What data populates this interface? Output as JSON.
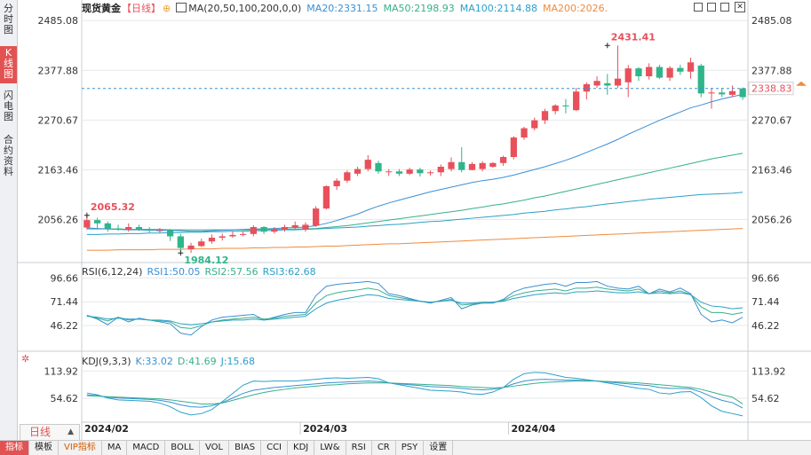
{
  "side_tabs": [
    {
      "label": "分时图",
      "active": false
    },
    {
      "label": "K线图",
      "active": true
    },
    {
      "label": "闪电图",
      "active": false
    },
    {
      "label": "合约资料",
      "active": false
    }
  ],
  "header": {
    "name": "现货黄金",
    "period": "【日线】",
    "ma_label": "MA(20,50,100,200,0,0)",
    "ma20": "MA20:2331.15",
    "ma50": "MA50:2198.93",
    "ma100": "MA100:2114.88",
    "ma200": "MA200:2026."
  },
  "rsi_header": {
    "name": "RSI(6,12,24)",
    "rsi1": "RSI1:50.05",
    "rsi2": "RSI2:57.56",
    "rsi3": "RSI3:62.68"
  },
  "kdj_header": {
    "name": "KDJ(9,3,3)",
    "k": "K:33.02",
    "d": "D:41.69",
    "j": "J:15.68"
  },
  "period_button": {
    "label": "日线",
    "arrow": "▲"
  },
  "bottom_tabs": [
    {
      "label": "指标",
      "active": true,
      "vip": false
    },
    {
      "label": "模板",
      "active": false,
      "vip": false
    },
    {
      "label": "VIP指标",
      "active": false,
      "vip": true
    },
    {
      "label": "MA",
      "active": false,
      "vip": false
    },
    {
      "label": "MACD",
      "active": false,
      "vip": false
    },
    {
      "label": "BOLL",
      "active": false,
      "vip": false
    },
    {
      "label": "VOL",
      "active": false,
      "vip": false
    },
    {
      "label": "BIAS",
      "active": false,
      "vip": false
    },
    {
      "label": "CCI",
      "active": false,
      "vip": false
    },
    {
      "label": "KDJ",
      "active": false,
      "vip": false
    },
    {
      "label": "LW&",
      "active": false,
      "vip": false
    },
    {
      "label": "RSI",
      "active": false,
      "vip": false
    },
    {
      "label": "CR",
      "active": false,
      "vip": false
    },
    {
      "label": "PSY",
      "active": false,
      "vip": false
    },
    {
      "label": "设置",
      "active": false,
      "vip": false
    }
  ],
  "colors": {
    "up": "#e8505b",
    "down": "#2fb58a",
    "ma20": "#3a8fd4",
    "ma50": "#37b08a",
    "ma100": "#2aa0c8",
    "ma200": "#f08a3c",
    "grid": "#e6e8eb",
    "dashed": "#3a8fd4"
  },
  "chart_data": [
    {
      "type": "candlestick",
      "title": "现货黄金",
      "yticks": [
        "2485.08",
        "2377.88",
        "2270.67",
        "2163.46",
        "2056.26"
      ],
      "ylim": [
        1975,
        2495
      ],
      "xticks": [
        "2024/02",
        "2024/03",
        "2024/04"
      ],
      "xtick_index": [
        0,
        21,
        41
      ],
      "current_price": 2338.83,
      "annotations": [
        {
          "text": "2065.32",
          "index": 0,
          "value": 2065.32,
          "kind": "high"
        },
        {
          "text": "1984.12",
          "index": 9,
          "value": 1984.12,
          "kind": "low"
        },
        {
          "text": "2431.41",
          "index": 50,
          "value": 2431.41,
          "kind": "high"
        }
      ],
      "candles": [
        [
          2039,
          2055,
          2065.32,
          2035
        ],
        [
          2055,
          2048,
          2060,
          2035
        ],
        [
          2048,
          2037,
          2052,
          2030
        ],
        [
          2037,
          2035,
          2045,
          2032
        ],
        [
          2035,
          2040,
          2048,
          2030
        ],
        [
          2040,
          2035,
          2045,
          2032
        ],
        [
          2035,
          2033,
          2040,
          2028
        ],
        [
          2033,
          2033,
          2038,
          2028
        ],
        [
          2033,
          2020,
          2036,
          2010
        ],
        [
          2020,
          1995,
          2025,
          1987
        ],
        [
          1992,
          2000,
          2006,
          1984.12
        ],
        [
          1999,
          2009,
          2015,
          1997
        ],
        [
          2009,
          2017,
          2024,
          2004
        ],
        [
          2017,
          2020,
          2026,
          2011
        ],
        [
          2020,
          2023,
          2030,
          2017
        ],
        [
          2023,
          2025,
          2031,
          2020
        ],
        [
          2025,
          2040,
          2044,
          2020
        ],
        [
          2040,
          2030,
          2042,
          2025
        ],
        [
          2030,
          2035,
          2040,
          2026
        ],
        [
          2035,
          2040,
          2045,
          2030
        ],
        [
          2040,
          2044,
          2052,
          2035
        ],
        [
          2035,
          2045,
          2050,
          2030
        ],
        [
          2043,
          2080,
          2085,
          2040
        ],
        [
          2080,
          2128,
          2130,
          2078
        ],
        [
          2128,
          2140,
          2145,
          2120
        ],
        [
          2140,
          2158,
          2162,
          2135
        ],
        [
          2155,
          2165,
          2170,
          2150
        ],
        [
          2165,
          2185,
          2195,
          2160
        ],
        [
          2178,
          2160,
          2183,
          2155
        ],
        [
          2160,
          2160,
          2165,
          2150
        ],
        [
          2160,
          2155,
          2165,
          2150
        ],
        [
          2155,
          2164,
          2168,
          2152
        ],
        [
          2164,
          2156,
          2168,
          2149
        ],
        [
          2156,
          2158,
          2162,
          2151
        ],
        [
          2158,
          2170,
          2175,
          2150
        ],
        [
          2165,
          2180,
          2190,
          2160
        ],
        [
          2180,
          2163,
          2212,
          2158
        ],
        [
          2163,
          2176,
          2180,
          2162
        ],
        [
          2165,
          2178,
          2182,
          2160
        ],
        [
          2170,
          2178,
          2180,
          2168
        ],
        [
          2178,
          2191,
          2194,
          2172
        ],
        [
          2191,
          2233,
          2236,
          2186
        ],
        [
          2233,
          2253,
          2256,
          2228
        ],
        [
          2253,
          2270,
          2276,
          2248
        ],
        [
          2270,
          2290,
          2295,
          2262
        ],
        [
          2290,
          2302,
          2305,
          2283
        ],
        [
          2302,
          2300,
          2316,
          2285
        ],
        [
          2292,
          2332,
          2340,
          2290
        ],
        [
          2332,
          2348,
          2352,
          2315
        ],
        [
          2345,
          2355,
          2365,
          2340
        ],
        [
          2350,
          2345,
          2370,
          2325
        ],
        [
          2345,
          2360,
          2431.41,
          2340
        ],
        [
          2352,
          2382,
          2389,
          2320
        ],
        [
          2382,
          2365,
          2385,
          2355
        ],
        [
          2365,
          2385,
          2393,
          2358
        ],
        [
          2385,
          2362,
          2390,
          2359
        ],
        [
          2362,
          2383,
          2387,
          2355
        ],
        [
          2383,
          2375,
          2390,
          2368
        ],
        [
          2375,
          2395,
          2405,
          2360
        ],
        [
          2388,
          2328,
          2392,
          2320
        ],
        [
          2328,
          2330,
          2340,
          2295
        ],
        [
          2330,
          2326,
          2340,
          2320
        ],
        [
          2325,
          2333,
          2345,
          2320
        ],
        [
          2338.83,
          2320,
          2341,
          2314
        ]
      ],
      "ma": {
        "ma20": [
          2038,
          2037,
          2036,
          2035,
          2034,
          2034,
          2033,
          2033,
          2033,
          2032,
          2031,
          2031,
          2032,
          2033,
          2034,
          2035,
          2036,
          2036,
          2037,
          2038,
          2039,
          2040,
          2043,
          2048,
          2054,
          2061,
          2068,
          2077,
          2085,
          2092,
          2098,
          2104,
          2110,
          2116,
          2121,
          2126,
          2131,
          2136,
          2140,
          2143,
          2147,
          2152,
          2158,
          2164,
          2170,
          2177,
          2184,
          2192,
          2201,
          2210,
          2219,
          2229,
          2240,
          2250,
          2260,
          2270,
          2279,
          2288,
          2297,
          2303,
          2310,
          2316,
          2321,
          2326
        ],
        "ma50": [
          2036,
          2036,
          2036,
          2036,
          2035,
          2035,
          2035,
          2035,
          2034,
          2034,
          2034,
          2034,
          2034,
          2034,
          2034,
          2034,
          2034,
          2035,
          2035,
          2035,
          2036,
          2036,
          2037,
          2039,
          2041,
          2043,
          2046,
          2049,
          2052,
          2055,
          2058,
          2061,
          2064,
          2067,
          2070,
          2073,
          2076,
          2080,
          2083,
          2087,
          2090,
          2094,
          2098,
          2103,
          2107,
          2112,
          2117,
          2122,
          2127,
          2132,
          2137,
          2142,
          2147,
          2152,
          2157,
          2162,
          2167,
          2172,
          2177,
          2182,
          2187,
          2191,
          2195,
          2199
        ],
        "ma100": [
          2024,
          2024,
          2025,
          2025,
          2026,
          2026,
          2027,
          2027,
          2028,
          2028,
          2029,
          2029,
          2030,
          2030,
          2031,
          2031,
          2032,
          2032,
          2033,
          2034,
          2034,
          2035,
          2036,
          2037,
          2038,
          2039,
          2040,
          2042,
          2043,
          2045,
          2046,
          2048,
          2050,
          2052,
          2053,
          2055,
          2057,
          2059,
          2061,
          2063,
          2065,
          2067,
          2070,
          2072,
          2074,
          2077,
          2079,
          2082,
          2084,
          2087,
          2090,
          2092,
          2095,
          2097,
          2100,
          2102,
          2104,
          2106,
          2108,
          2110,
          2111,
          2112,
          2113,
          2115
        ],
        "ma200": [
          1990,
          1990,
          1990,
          1991,
          1991,
          1991,
          1991,
          1992,
          1992,
          1992,
          1993,
          1993,
          1993,
          1994,
          1994,
          1994,
          1995,
          1995,
          1996,
          1996,
          1997,
          1997,
          1998,
          1999,
          1999,
          2000,
          2001,
          2002,
          2003,
          2004,
          2004,
          2005,
          2006,
          2007,
          2008,
          2009,
          2010,
          2011,
          2012,
          2013,
          2014,
          2015,
          2016,
          2017,
          2018,
          2019,
          2020,
          2021,
          2022,
          2023,
          2024,
          2025,
          2026,
          2027,
          2028,
          2029,
          2030,
          2031,
          2032,
          2033,
          2034,
          2035,
          2036,
          2037
        ]
      }
    },
    {
      "type": "line",
      "title": "RSI(6,12,24)",
      "yticks": [
        "96.66",
        "71.44",
        "46.22"
      ],
      "ylim": [
        32,
        100
      ],
      "series": [
        {
          "name": "RSI1",
          "values": [
            57,
            53,
            47,
            55,
            50,
            54,
            52,
            50,
            48,
            38,
            36,
            45,
            52,
            55,
            56,
            57,
            58,
            52,
            55,
            58,
            60,
            60,
            78,
            88,
            90,
            91,
            92,
            93,
            91,
            80,
            78,
            75,
            72,
            70,
            73,
            76,
            64,
            68,
            70,
            70,
            74,
            82,
            86,
            88,
            90,
            91,
            88,
            92,
            92,
            93,
            88,
            86,
            85,
            88,
            80,
            85,
            82,
            86,
            80,
            58,
            50,
            52,
            49,
            55
          ]
        },
        {
          "name": "RSI2",
          "values": [
            57,
            54,
            51,
            55,
            52,
            53,
            52,
            51,
            50,
            44,
            43,
            46,
            50,
            52,
            53,
            54,
            55,
            53,
            54,
            56,
            57,
            58,
            70,
            78,
            81,
            83,
            84,
            86,
            84,
            78,
            76,
            74,
            72,
            71,
            72,
            74,
            68,
            69,
            70,
            71,
            73,
            78,
            81,
            83,
            84,
            85,
            83,
            86,
            86,
            87,
            85,
            84,
            83,
            85,
            80,
            83,
            81,
            83,
            79,
            66,
            60,
            60,
            58,
            60
          ]
        },
        {
          "name": "RSI3",
          "values": [
            56,
            55,
            53,
            54,
            53,
            53,
            52,
            52,
            51,
            48,
            47,
            48,
            50,
            51,
            52,
            52,
            53,
            52,
            53,
            54,
            55,
            56,
            64,
            70,
            73,
            75,
            77,
            79,
            78,
            75,
            74,
            73,
            72,
            71,
            72,
            73,
            70,
            70,
            71,
            71,
            72,
            75,
            77,
            79,
            80,
            81,
            80,
            82,
            82,
            83,
            82,
            81,
            81,
            82,
            80,
            81,
            80,
            81,
            79,
            71,
            67,
            66,
            64,
            65
          ]
        }
      ]
    },
    {
      "type": "line",
      "title": "KDJ(9,3,3)",
      "yticks": [
        "113.92",
        "54.62"
      ],
      "ylim": [
        10,
        130
      ],
      "series": [
        {
          "name": "K",
          "values": [
            62,
            60,
            57,
            55,
            54,
            53,
            52,
            50,
            46,
            40,
            36,
            35,
            38,
            45,
            55,
            65,
            72,
            75,
            78,
            80,
            82,
            84,
            86,
            88,
            89,
            90,
            91,
            92,
            91,
            88,
            86,
            84,
            82,
            80,
            79,
            78,
            76,
            74,
            73,
            74,
            78,
            86,
            92,
            95,
            96,
            95,
            94,
            94,
            93,
            92,
            90,
            88,
            86,
            84,
            82,
            78,
            76,
            76,
            75,
            68,
            58,
            50,
            45,
            33
          ]
        },
        {
          "name": "D",
          "values": [
            60,
            59,
            58,
            57,
            56,
            55,
            54,
            53,
            51,
            48,
            45,
            42,
            42,
            44,
            50,
            56,
            62,
            67,
            71,
            74,
            77,
            79,
            81,
            83,
            84,
            86,
            87,
            88,
            88,
            88,
            87,
            86,
            85,
            84,
            83,
            82,
            80,
            79,
            78,
            77,
            78,
            81,
            84,
            87,
            89,
            90,
            91,
            92,
            92,
            92,
            91,
            90,
            89,
            88,
            86,
            84,
            82,
            80,
            78,
            74,
            68,
            62,
            57,
            42
          ]
        },
        {
          "name": "J",
          "values": [
            66,
            62,
            55,
            51,
            50,
            49,
            48,
            44,
            36,
            24,
            18,
            21,
            30,
            47,
            65,
            83,
            92,
            91,
            92,
            92,
            92,
            94,
            96,
            98,
            99,
            98,
            99,
            100,
            97,
            88,
            84,
            80,
            76,
            72,
            71,
            70,
            68,
            64,
            63,
            68,
            78,
            96,
            108,
            111,
            110,
            105,
            100,
            98,
            95,
            92,
            88,
            84,
            80,
            76,
            74,
            66,
            64,
            68,
            69,
            56,
            38,
            26,
            21,
            16
          ]
        }
      ]
    }
  ]
}
